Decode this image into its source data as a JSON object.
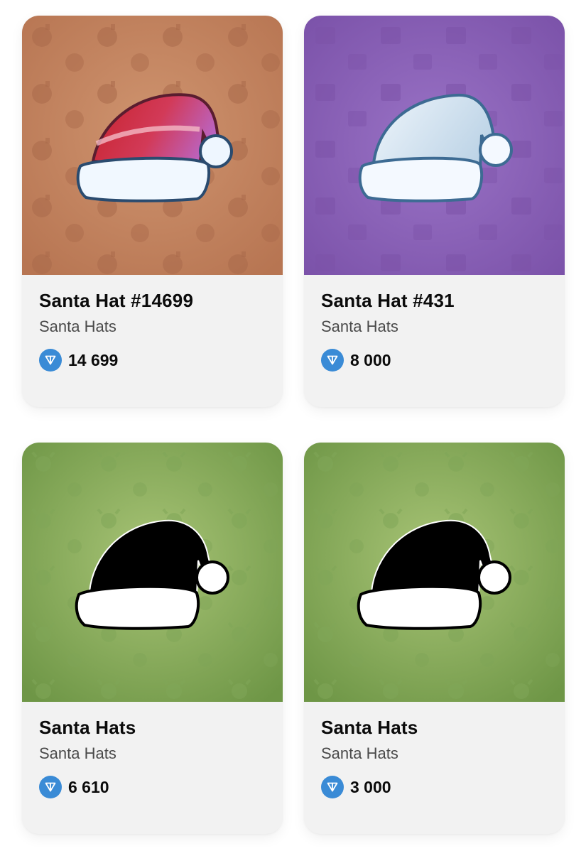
{
  "items": [
    {
      "title": "Santa Hat #14699",
      "collection": "Santa Hats",
      "price": "14 699",
      "background": "#c0805e",
      "hat_style": "red-pink"
    },
    {
      "title": "Santa Hat #431",
      "collection": "Santa Hats",
      "price": "8 000",
      "background": "#8c62b8",
      "hat_style": "white"
    },
    {
      "title": "Santa Hats",
      "collection": "Santa Hats",
      "price": "6 610",
      "background": "#8cae5e",
      "hat_style": "black-silhouette"
    },
    {
      "title": "Santa Hats",
      "collection": "Santa Hats",
      "price": "3 000",
      "background": "#8cae5e",
      "hat_style": "black-silhouette"
    }
  ],
  "currency_icon": "ton-diamond-icon",
  "accent": "#3a8bd6"
}
